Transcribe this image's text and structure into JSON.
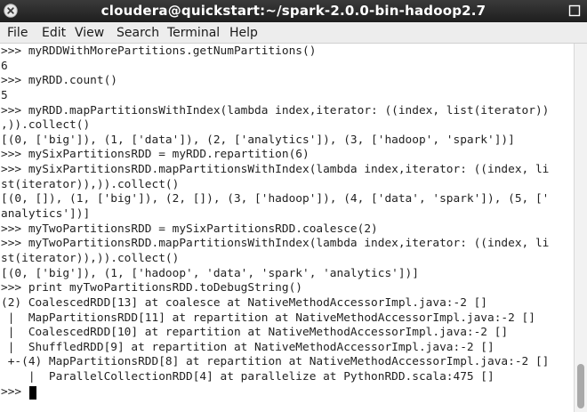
{
  "window": {
    "title": "cloudera@quickstart:~/spark-2.0.0-bin-hadoop2.7"
  },
  "menu": {
    "items": [
      "File",
      "Edit",
      "View",
      "Search",
      "Terminal",
      "Help"
    ]
  },
  "terminal": {
    "lines": [
      ">>> myRDDWithMorePartitions.getNumPartitions()",
      "6",
      ">>> myRDD.count()",
      "5",
      ">>> myRDD.mapPartitionsWithIndex(lambda index,iterator: ((index, list(iterator))",
      ",)).collect()",
      "[(0, ['big']), (1, ['data']), (2, ['analytics']), (3, ['hadoop', 'spark'])]",
      ">>> mySixPartitionsRDD = myRDD.repartition(6)",
      ">>> mySixPartitionsRDD.mapPartitionsWithIndex(lambda index,iterator: ((index, li",
      "st(iterator)),)).collect()",
      "[(0, []), (1, ['big']), (2, []), (3, ['hadoop']), (4, ['data', 'spark']), (5, ['",
      "analytics'])]",
      ">>> myTwoPartitionsRDD = mySixPartitionsRDD.coalesce(2)",
      ">>> myTwoPartitionsRDD.mapPartitionsWithIndex(lambda index,iterator: ((index, li",
      "st(iterator)),)).collect()",
      "[(0, ['big']), (1, ['hadoop', 'data', 'spark', 'analytics'])]",
      ">>> print myTwoPartitionsRDD.toDebugString()",
      "(2) CoalescedRDD[13] at coalesce at NativeMethodAccessorImpl.java:-2 []",
      " |  MapPartitionsRDD[11] at repartition at NativeMethodAccessorImpl.java:-2 []",
      " |  CoalescedRDD[10] at repartition at NativeMethodAccessorImpl.java:-2 []",
      " |  ShuffledRDD[9] at repartition at NativeMethodAccessorImpl.java:-2 []",
      " +-(4) MapPartitionsRDD[8] at repartition at NativeMethodAccessorImpl.java:-2 []",
      "    |  ParallelCollectionRDD[4] at parallelize at PythonRDD.scala:475 []"
    ],
    "prompt": ">>> "
  },
  "colors": {
    "titlebar_bg": "#2b2b2b",
    "close_button": "#e8e8e8",
    "terminal_text": "#222222",
    "terminal_bg": "#ffffff"
  }
}
